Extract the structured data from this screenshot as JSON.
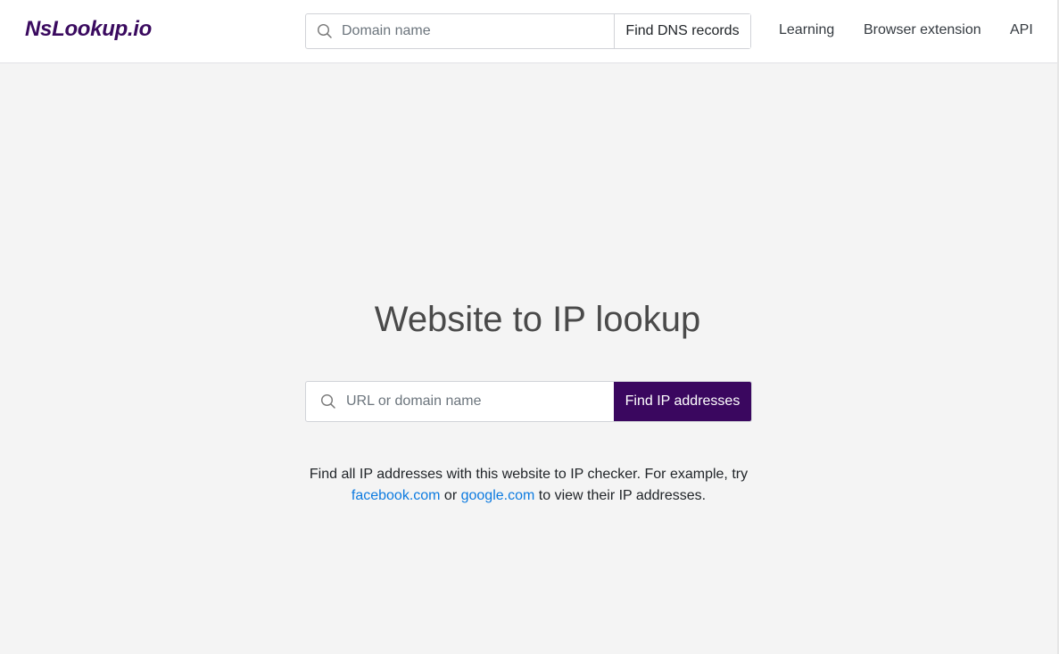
{
  "header": {
    "logo": "NsLookup.io",
    "search": {
      "placeholder": "Domain name",
      "value": "",
      "button_label": "Find DNS records",
      "icon": "search-icon"
    },
    "nav": [
      {
        "label": "Learning"
      },
      {
        "label": "Browser extension"
      },
      {
        "label": "API"
      }
    ]
  },
  "main": {
    "title": "Website to IP lookup",
    "search": {
      "placeholder": "URL or domain name",
      "value": "",
      "button_label": "Find IP addresses",
      "icon": "search-icon"
    },
    "description": {
      "line1": "Find all IP addresses with this website to IP checker. For example, try",
      "link1": "facebook.com",
      "connector": " or ",
      "link2": "google.com",
      "tail": " to view their IP addresses."
    }
  },
  "colors": {
    "brand": "#3a075f",
    "link": "#0d7be0",
    "background": "#f4f4f4"
  }
}
